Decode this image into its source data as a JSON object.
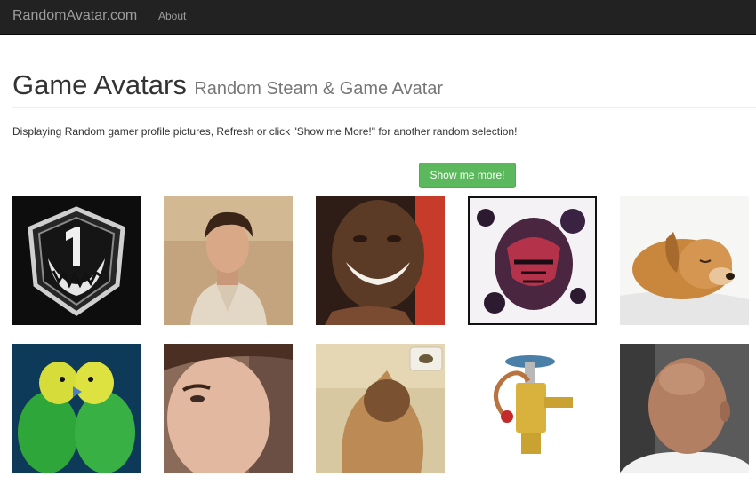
{
  "navbar": {
    "brand": "RandomAvatar.com",
    "links": [
      "About"
    ]
  },
  "header": {
    "title": "Game Avatars",
    "subtitle": "Random Steam & Game Avatar"
  },
  "intro": "Displaying Random gamer profile pictures, Refresh or click \"Show me More!\" for another random selection!",
  "button": {
    "label": "Show me more!",
    "color": "#5cb85c"
  },
  "avatars": [
    {
      "subject": "skull-badge-emblem"
    },
    {
      "subject": "young-man-portrait"
    },
    {
      "subject": "smiling-woman"
    },
    {
      "subject": "masked-figure-art"
    },
    {
      "subject": "sleeping-puppy"
    },
    {
      "subject": "green-parakeets"
    },
    {
      "subject": "man-selfie-closeup"
    },
    {
      "subject": "siamese-cat"
    },
    {
      "subject": "expansion-valve"
    },
    {
      "subject": "bald-man-back-of-head"
    }
  ]
}
